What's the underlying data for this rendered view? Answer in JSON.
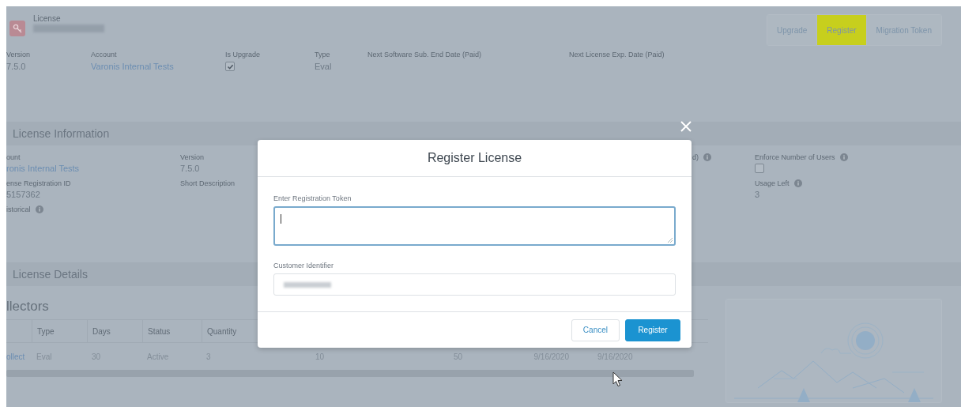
{
  "header": {
    "object_type": "License"
  },
  "actions": [
    {
      "label": "Upgrade",
      "highlighted": false
    },
    {
      "label": "Register",
      "highlighted": true
    },
    {
      "label": "Migration Token",
      "highlighted": false
    }
  ],
  "summary_fields": [
    {
      "label": "Version",
      "value": "7.5.0",
      "kind": "text"
    },
    {
      "label": "Account",
      "value": "Varonis Internal Tests",
      "kind": "link"
    },
    {
      "label": "Is Upgrade",
      "kind": "checkbox",
      "checked": true
    },
    {
      "label": "Type",
      "value": "Eval",
      "kind": "text"
    },
    {
      "label": "Next Software Sub. End Date (Paid)",
      "kind": "text"
    },
    {
      "label": "Next License Exp. Date (Paid)",
      "kind": "text"
    }
  ],
  "license_information": {
    "title": "License Information",
    "columns": [
      [
        {
          "label": "ount",
          "value": "ronis Internal Tests",
          "kind": "link",
          "info": false
        },
        {
          "label": "ense Registration ID",
          "value": "5157362",
          "kind": "text",
          "info": false
        },
        {
          "label": "istorical",
          "kind": "text",
          "info": true
        }
      ],
      [
        {
          "label": "Version",
          "value": "7.5.0",
          "kind": "text",
          "info": false
        },
        {
          "label": "Short Description",
          "kind": "text",
          "info": false
        }
      ],
      [
        {
          "label": "d)",
          "kind": "text",
          "info": true
        }
      ],
      [
        {
          "label": "Enforce Number of Users",
          "kind": "checkbox",
          "checked": false,
          "info": true
        },
        {
          "label": "Usage Left",
          "value": "3",
          "kind": "text",
          "info": true
        }
      ]
    ]
  },
  "license_details": {
    "title": "License Details",
    "subsection": "llectors",
    "table": {
      "columns": [
        "",
        "Type",
        "Days",
        "Status",
        "Quantity"
      ],
      "rows": [
        {
          "cells": [
            "ollect",
            "Eval",
            "30",
            "Active",
            "3",
            "10",
            "50",
            "9/16/2020",
            "9/16/2020"
          ]
        }
      ]
    }
  },
  "modal": {
    "title": "Register License",
    "fields": [
      {
        "label": "Enter Registration Token",
        "kind": "textarea",
        "focused": true
      },
      {
        "label": "Customer Identifier",
        "kind": "input",
        "focused": false
      }
    ],
    "buttons": [
      {
        "label": "Cancel",
        "primary": false
      },
      {
        "label": "Register",
        "primary": true
      }
    ]
  }
}
